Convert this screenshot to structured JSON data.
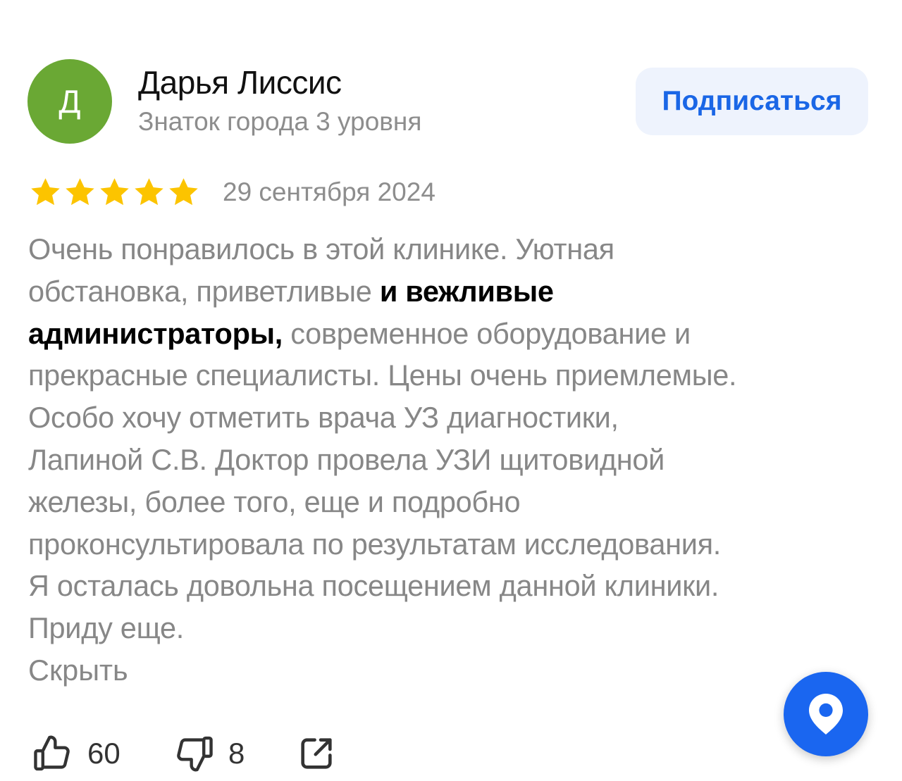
{
  "author": {
    "initial": "Д",
    "name": "Дарья Лиссис",
    "level": "Знаток города 3 уровня",
    "avatar_color": "#6aa834"
  },
  "subscribe": {
    "label": "Подписаться",
    "text_color": "#1a66e6",
    "bg_color": "#eef3fd"
  },
  "review": {
    "rating": 5,
    "rating_max": 5,
    "star_color": "#fcc400",
    "date": "29 сентября 2024",
    "lines": [
      [
        "Очень понравилось в этой клинике. Уютная"
      ],
      [
        "обстановка, приветливые ",
        "и вежливые"
      ],
      [
        "администраторы,",
        " современное оборудование и"
      ],
      [
        "прекрасные специалисты. Цены очень приемлемые."
      ],
      [
        "Особо хочу отметить врача УЗ диагностики,"
      ],
      [
        "Лапиной С.В. Доктор провела УЗИ щитовидной"
      ],
      [
        "железы, более того, еще и подробно"
      ],
      [
        "проконсультировала по результатам исследования."
      ],
      [
        "Я осталась довольна посещением данной клиники."
      ],
      [
        "Приду еще."
      ]
    ],
    "hide_label": "Скрыть"
  },
  "actions": {
    "like_icon": "thumbs-up-icon",
    "likes": "60",
    "dislike_icon": "thumbs-down-icon",
    "dislikes": "8",
    "share_icon": "share-icon"
  },
  "fab": {
    "icon": "map-pin-icon",
    "color": "#1a66f0"
  }
}
